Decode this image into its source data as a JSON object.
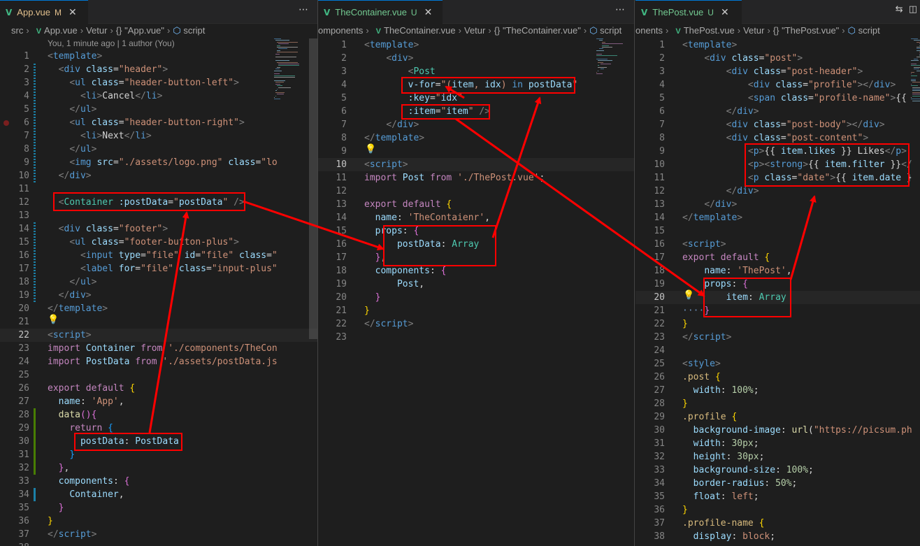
{
  "panes": [
    {
      "tab": {
        "name": "App.vue",
        "status": "M"
      },
      "breadcrumb": [
        "src",
        "App.vue",
        "Vetur",
        "{} \"App.vue\"",
        "script"
      ],
      "codelens": "You, 1 minute ago | 1 author (You)",
      "current_line": "22",
      "lines": [
        {
          "n": "1",
          "html": "<span class='t'>&lt;</span><span class='tg'>template</span><span class='t'>&gt;</span>"
        },
        {
          "n": "2",
          "html": "  <span class='t'>&lt;</span><span class='tg'>div</span> <span class='at'>class</span>=<span class='s'>\"header\"</span><span class='t'>&gt;</span>"
        },
        {
          "n": "3",
          "html": "    <span class='t'>&lt;</span><span class='tg'>ul</span> <span class='at'>class</span>=<span class='s'>\"header-button-left\"</span><span class='t'>&gt;</span>"
        },
        {
          "n": "4",
          "html": "      <span class='t'>&lt;</span><span class='tg'>li</span><span class='t'>&gt;</span>Cancel<span class='t'>&lt;/</span><span class='tg'>li</span><span class='t'>&gt;</span>"
        },
        {
          "n": "5",
          "html": "    <span class='t'>&lt;/</span><span class='tg'>ul</span><span class='t'>&gt;</span>"
        },
        {
          "n": "6",
          "html": "    <span class='t'>&lt;</span><span class='tg'>ul</span> <span class='at'>class</span>=<span class='s'>\"header-button-right\"</span><span class='t'>&gt;</span>"
        },
        {
          "n": "7",
          "html": "      <span class='t'>&lt;</span><span class='tg'>li</span><span class='t'>&gt;</span>Next<span class='t'>&lt;/</span><span class='tg'>li</span><span class='t'>&gt;</span>"
        },
        {
          "n": "8",
          "html": "    <span class='t'>&lt;/</span><span class='tg'>ul</span><span class='t'>&gt;</span>"
        },
        {
          "n": "9",
          "html": "    <span class='t'>&lt;</span><span class='tg'>img</span> <span class='at'>src</span>=<span class='s'>\"./assets/logo.png\"</span> <span class='at'>class</span>=<span class='s'>\"lo</span>"
        },
        {
          "n": "10",
          "html": "  <span class='t'>&lt;/</span><span class='tg'>div</span><span class='t'>&gt;</span>"
        },
        {
          "n": "11",
          "html": ""
        },
        {
          "n": "12",
          "html": "  <span class='t'>&lt;</span><span class='c'>Container</span> <span class='at'>:postData</span>=<span class='s'>\"</span><span class='v2'>postData</span><span class='s'>\"</span> <span class='t'>/&gt;</span>"
        },
        {
          "n": "13",
          "html": ""
        },
        {
          "n": "14",
          "html": "  <span class='t'>&lt;</span><span class='tg'>div</span> <span class='at'>class</span>=<span class='s'>\"footer\"</span><span class='t'>&gt;</span>"
        },
        {
          "n": "15",
          "html": "    <span class='t'>&lt;</span><span class='tg'>ul</span> <span class='at'>class</span>=<span class='s'>\"footer-button-plus\"</span><span class='t'>&gt;</span>"
        },
        {
          "n": "16",
          "html": "      <span class='t'>&lt;</span><span class='tg'>input</span> <span class='at'>type</span>=<span class='s'>\"file\"</span> <span class='at'>id</span>=<span class='s'>\"file\"</span> <span class='at'>class</span>=<span class='s'>\"</span>"
        },
        {
          "n": "17",
          "html": "      <span class='t'>&lt;</span><span class='tg'>label</span> <span class='at'>for</span>=<span class='s'>\"file\"</span> <span class='at'>class</span>=<span class='s'>\"input-plus\"</span>"
        },
        {
          "n": "18",
          "html": "    <span class='t'>&lt;/</span><span class='tg'>ul</span><span class='t'>&gt;</span>"
        },
        {
          "n": "19",
          "html": "  <span class='t'>&lt;/</span><span class='tg'>div</span><span class='t'>&gt;</span>"
        },
        {
          "n": "20",
          "html": "<span class='t'>&lt;/</span><span class='tg'>template</span><span class='t'>&gt;</span>"
        },
        {
          "n": "21",
          "html": ""
        },
        {
          "n": "22",
          "html": "<span class='t'>&lt;</span><span class='tg'>script</span><span class='t'>&gt;</span>"
        },
        {
          "n": "23",
          "html": "<span class='k'>import</span> <span class='v2'>Container</span> <span class='k'>from</span> <span class='s'>'./components/TheCon</span>"
        },
        {
          "n": "24",
          "html": "<span class='k'>import</span> <span class='v2'>PostData</span> <span class='k'>from</span> <span class='s'>'./assets/postData.js</span>"
        },
        {
          "n": "25",
          "html": ""
        },
        {
          "n": "26",
          "html": "<span class='k'>export</span> <span class='k'>default</span> <span class='b1'>{</span>"
        },
        {
          "n": "27",
          "html": "  <span class='pr'>name</span>: <span class='s'>'App'</span>,"
        },
        {
          "n": "28",
          "html": "  <span class='y'>data</span><span class='b2'>()</span><span class='b2'>{</span>"
        },
        {
          "n": "29",
          "html": "    <span class='k'>return</span> <span class='b3'>{</span>"
        },
        {
          "n": "30",
          "html": "      <span class='pr'>postData</span>: <span class='v2'>PostData</span>"
        },
        {
          "n": "31",
          "html": "    <span class='b3'>}</span>"
        },
        {
          "n": "32",
          "html": "  <span class='b2'>}</span>,"
        },
        {
          "n": "33",
          "html": "  <span class='pr'>components</span>: <span class='b2'>{</span>"
        },
        {
          "n": "34",
          "html": "    <span class='v2'>Container</span>,"
        },
        {
          "n": "35",
          "html": "  <span class='b2'>}</span>"
        },
        {
          "n": "36",
          "html": "<span class='b1'>}</span>"
        },
        {
          "n": "37",
          "html": "<span class='t'>&lt;/</span><span class='tg'>script</span><span class='t'>&gt;</span>"
        },
        {
          "n": "38",
          "html": ""
        }
      ]
    },
    {
      "tab": {
        "name": "TheContainer.vue",
        "status": "U"
      },
      "breadcrumb": [
        "omponents",
        "TheContainer.vue",
        "Vetur",
        "{} \"TheContainer.vue\"",
        "script"
      ],
      "current_line": "10",
      "lines": [
        {
          "n": "1",
          "html": "<span class='t'>&lt;</span><span class='tg'>template</span><span class='t'>&gt;</span>"
        },
        {
          "n": "2",
          "html": "    <span class='t'>&lt;</span><span class='tg'>div</span><span class='t'>&gt;</span>"
        },
        {
          "n": "3",
          "html": "        <span class='t'>&lt;</span><span class='c'>Post</span>"
        },
        {
          "n": "4",
          "html": "        <span class='at'>v-for</span>=<span class='s'>\"(</span><span class='v2'>item</span><span class='s'>, </span><span class='v2'>idx</span><span class='s'>) </span><span class='d'>in</span><span class='s'> </span><span class='v2'>postData</span><span class='s'>\"</span>"
        },
        {
          "n": "5",
          "html": "        <span class='at'>:key</span>=<span class='s'>\"</span><span class='v2'>idx</span><span class='s'>\"</span>"
        },
        {
          "n": "6",
          "html": "        <span class='at'>:item</span>=<span class='s'>\"</span><span class='v2'>item</span><span class='s'>\"</span> <span class='t'>/&gt;</span>"
        },
        {
          "n": "7",
          "html": "    <span class='t'>&lt;/</span><span class='tg'>div</span><span class='t'>&gt;</span>"
        },
        {
          "n": "8",
          "html": "<span class='t'>&lt;/</span><span class='tg'>template</span><span class='t'>&gt;</span>"
        },
        {
          "n": "9",
          "html": ""
        },
        {
          "n": "10",
          "html": "<span class='t'>&lt;</span><span class='tg'>script</span><span class='t'>&gt;</span>"
        },
        {
          "n": "11",
          "html": "<span class='k'>import</span> <span class='v2'>Post</span> <span class='k'>from</span> <span class='s'>'./ThePost.vue'</span>;"
        },
        {
          "n": "12",
          "html": ""
        },
        {
          "n": "13",
          "html": "<span class='k'>export</span> <span class='k'>default</span> <span class='b1'>{</span>"
        },
        {
          "n": "14",
          "html": "  <span class='pr'>name</span>: <span class='s'>'TheContaienr'</span>,"
        },
        {
          "n": "15",
          "html": "  <span class='pr'>props</span>: <span class='b2'>{</span>"
        },
        {
          "n": "16",
          "html": "      <span class='pr'>postData</span>: <span class='c'>Array</span>"
        },
        {
          "n": "17",
          "html": "  <span class='b2'>}</span>,"
        },
        {
          "n": "18",
          "html": "  <span class='pr'>components</span>: <span class='b2'>{</span>"
        },
        {
          "n": "19",
          "html": "      <span class='v2'>Post</span>,"
        },
        {
          "n": "20",
          "html": "  <span class='b2'>}</span>"
        },
        {
          "n": "21",
          "html": "<span class='b1'>}</span>"
        },
        {
          "n": "22",
          "html": "<span class='t'>&lt;/</span><span class='tg'>script</span><span class='t'>&gt;</span>"
        },
        {
          "n": "23",
          "html": ""
        }
      ]
    },
    {
      "tab": {
        "name": "ThePost.vue",
        "status": "U"
      },
      "breadcrumb": [
        "onents",
        "ThePost.vue",
        "Vetur",
        "{} \"ThePost.vue\"",
        "script"
      ],
      "current_line": "20",
      "lines": [
        {
          "n": "1",
          "html": "<span class='t'>&lt;</span><span class='tg'>template</span><span class='t'>&gt;</span>"
        },
        {
          "n": "2",
          "html": "    <span class='t'>&lt;</span><span class='tg'>div</span> <span class='at'>class</span>=<span class='s'>\"post\"</span><span class='t'>&gt;</span>"
        },
        {
          "n": "3",
          "html": "        <span class='t'>&lt;</span><span class='tg'>div</span> <span class='at'>class</span>=<span class='s'>\"post-header\"</span><span class='t'>&gt;</span>"
        },
        {
          "n": "4",
          "html": "            <span class='t'>&lt;</span><span class='tg'>div</span> <span class='at'>class</span>=<span class='s'>\"profile\"</span><span class='t'>&gt;&lt;/</span><span class='tg'>div</span><span class='t'>&gt;</span>"
        },
        {
          "n": "5",
          "html": "            <span class='t'>&lt;</span><span class='tg'>span</span> <span class='at'>class</span>=<span class='s'>\"profile-name\"</span><span class='t'>&gt;</span>{{"
        },
        {
          "n": "6",
          "html": "        <span class='t'>&lt;/</span><span class='tg'>div</span><span class='t'>&gt;</span>"
        },
        {
          "n": "7",
          "html": "        <span class='t'>&lt;</span><span class='tg'>div</span> <span class='at'>class</span>=<span class='s'>\"post-body\"</span><span class='t'>&gt;&lt;/</span><span class='tg'>div</span><span class='t'>&gt;</span>"
        },
        {
          "n": "8",
          "html": "        <span class='t'>&lt;</span><span class='tg'>div</span> <span class='at'>class</span>=<span class='s'>\"post-content\"</span><span class='t'>&gt;</span>"
        },
        {
          "n": "9",
          "html": "            <span class='t'>&lt;</span><span class='tg'>p</span><span class='t'>&gt;</span>{{ <span class='v2'>item</span>.<span class='v2'>likes</span> }} Likes<span class='t'>&lt;/</span><span class='tg'>p</span><span class='t'>&gt;</span>"
        },
        {
          "n": "10",
          "html": "            <span class='t'>&lt;</span><span class='tg'>p</span><span class='t'>&gt;&lt;</span><span class='tg'>strong</span><span class='t'>&gt;</span>{{ <span class='v2'>item</span>.<span class='v2'>filter</span> }}<span class='t'>&lt;/</span>"
        },
        {
          "n": "11",
          "html": "            <span class='t'>&lt;</span><span class='tg'>p</span> <span class='at'>class</span>=<span class='s'>\"date\"</span><span class='t'>&gt;</span>{{ <span class='v2'>item</span>.<span class='v2'>date</span> }"
        },
        {
          "n": "12",
          "html": "        <span class='t'>&lt;/</span><span class='tg'>div</span><span class='t'>&gt;</span>"
        },
        {
          "n": "13",
          "html": "    <span class='t'>&lt;/</span><span class='tg'>div</span><span class='t'>&gt;</span>"
        },
        {
          "n": "14",
          "html": "<span class='t'>&lt;/</span><span class='tg'>template</span><span class='t'>&gt;</span>"
        },
        {
          "n": "15",
          "html": ""
        },
        {
          "n": "16",
          "html": "<span class='t'>&lt;</span><span class='tg'>script</span><span class='t'>&gt;</span>"
        },
        {
          "n": "17",
          "html": "<span class='k'>export</span> <span class='k'>default</span> <span class='b1'>{</span>"
        },
        {
          "n": "18",
          "html": "    <span class='pr'>name</span>: <span class='s'>'ThePost'</span>,"
        },
        {
          "n": "19",
          "html": "    <span class='pr'>props</span>: <span class='b2'>{</span>"
        },
        {
          "n": "20",
          "html": "        <span class='pr'>item</span>: <span class='c'>Array</span>"
        },
        {
          "n": "21",
          "html": "<span style='color:#6d8fb8'>····</span><span class='b2'>}</span>"
        },
        {
          "n": "22",
          "html": "<span class='b1'>}</span>"
        },
        {
          "n": "23",
          "html": "<span class='t'>&lt;/</span><span class='tg'>script</span><span class='t'>&gt;</span>"
        },
        {
          "n": "24",
          "html": ""
        },
        {
          "n": "25",
          "html": "<span class='t'>&lt;</span><span class='tg'>style</span><span class='t'>&gt;</span>"
        },
        {
          "n": "26",
          "html": "<span class='sel'>.post</span> <span class='b1'>{</span>"
        },
        {
          "n": "27",
          "html": "  <span class='pr'>width</span>: <span class='n'>100%</span>;"
        },
        {
          "n": "28",
          "html": "<span class='b1'>}</span>"
        },
        {
          "n": "29",
          "html": "<span class='sel'>.profile</span> <span class='b1'>{</span>"
        },
        {
          "n": "30",
          "html": "  <span class='pr'>background-image</span>: <span class='y'>url</span>(<span class='s'>\"https://picsum.ph</span>"
        },
        {
          "n": "31",
          "html": "  <span class='pr'>width</span>: <span class='n'>30px</span>;"
        },
        {
          "n": "32",
          "html": "  <span class='pr'>height</span>: <span class='n'>30px</span>;"
        },
        {
          "n": "33",
          "html": "  <span class='pr'>background-size</span>: <span class='n'>100%</span>;"
        },
        {
          "n": "34",
          "html": "  <span class='pr'>border-radius</span>: <span class='n'>50%</span>;"
        },
        {
          "n": "35",
          "html": "  <span class='pr'>float</span>: <span class='s'>left</span>;"
        },
        {
          "n": "36",
          "html": "<span class='b1'>}</span>"
        },
        {
          "n": "37",
          "html": "<span class='sel'>.profile-name</span> <span class='b1'>{</span>"
        },
        {
          "n": "38",
          "html": "  <span class='pr'>display</span>: <span class='s'>block</span>;"
        }
      ]
    }
  ],
  "colors": {
    "annotation": "#ff0000",
    "vue_logo": "#41b883",
    "modified": "#e2c08d"
  },
  "icons": {
    "more": "⋯",
    "close": "✕",
    "lightbulb": "💡",
    "compare": "⇆",
    "split": "◫"
  }
}
